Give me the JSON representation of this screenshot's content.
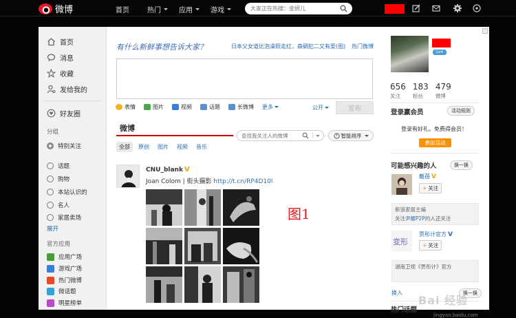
{
  "brand": {
    "name": "微博",
    "accent": "#e6162d"
  },
  "topnav": {
    "items": [
      {
        "label": "首页",
        "has_caret": false
      },
      {
        "label": "热门",
        "has_caret": true
      },
      {
        "label": "应用",
        "has_caret": true
      },
      {
        "label": "游戏",
        "has_caret": true
      }
    ],
    "search_placeholder": "大家正在热搜：金妍儿",
    "icons": [
      "compose-icon",
      "mail-icon",
      "gear-icon",
      "grid-icon"
    ]
  },
  "leftnav": {
    "main": [
      {
        "label": "首页",
        "icon": "home-icon"
      },
      {
        "label": "消息",
        "icon": "message-icon"
      },
      {
        "label": "收藏",
        "icon": "star-icon"
      },
      {
        "label": "发给我的",
        "icon": "person-icon"
      }
    ],
    "friends_circle": "好友圈",
    "group_section": "分组",
    "special_follow": "特别关注",
    "groups": [
      "话题",
      "购物",
      "本站认识的",
      "名人",
      "家居卖场"
    ],
    "expand": "展开",
    "apps_section": "官方应用",
    "apps": [
      {
        "label": "应用广场",
        "color": "#4a9d3a"
      },
      {
        "label": "游戏广场",
        "color": "#3a7ed8"
      },
      {
        "label": "热门微博",
        "color": "#e24a2a"
      },
      {
        "label": "微话题",
        "color": "#3aa0d8"
      },
      {
        "label": "明星榜单",
        "color": "#b84ac8"
      }
    ]
  },
  "composer": {
    "prompt": "有什么新鲜事想告诉大家？",
    "hot_topic": "日本父女道比泡澡照走红，森碉犯二又有爱(图)",
    "hot_weibo": "热门微博",
    "tools": [
      {
        "label": "表情",
        "color": "#f2b31a"
      },
      {
        "label": "图片",
        "color": "#4aa84a"
      },
      {
        "label": "视频",
        "color": "#3a7ed8"
      },
      {
        "label": "话题",
        "color": "#5a8fd0"
      },
      {
        "label": "长微博",
        "color": "#5a8fd0"
      }
    ],
    "more": "更多",
    "visibility": "公开",
    "publish": "发布"
  },
  "feed": {
    "tab": "微博",
    "search_placeholder": "查找我关注人的微博",
    "sort": "智能排序",
    "filters": [
      "全部",
      "原创",
      "图片",
      "视频",
      "音乐"
    ],
    "post": {
      "author": "CNU_blank",
      "verified": "V",
      "text": "Joan Colom | 街头摄影 ",
      "link": "http://t.cn/RP4D10l"
    },
    "figure_label": "图1"
  },
  "right": {
    "stats": [
      {
        "num": "656",
        "label": "关注"
      },
      {
        "num": "183",
        "label": "粉丝"
      },
      {
        "num": "479",
        "label": "微博"
      }
    ],
    "tag": "Lv4",
    "login_title": "登录赢会员",
    "rules": "活动规则",
    "login_desc": "登录有好礼，免费得会员！",
    "join": "参加活动",
    "interest_title": "可能感兴趣的人",
    "refresh": "换一换",
    "follow": "关注",
    "users": [
      {
        "name": "戴蓓",
        "verified": "V"
      },
      {
        "name": "贾彤计官方",
        "verified": "V"
      }
    ],
    "note1": {
      "line1": "新浪家居主编",
      "line2_prefix": "关注",
      "line2_link": "尹娜P2P",
      "line2_suffix": "的人还关注"
    },
    "note2": {
      "line1": "湖南卫视《贾彤计》官方"
    },
    "hot_title": "热门话题",
    "insert": "换入",
    "watermark": "Bai 经验",
    "watermark_url": "jingyan.baidu.com"
  }
}
